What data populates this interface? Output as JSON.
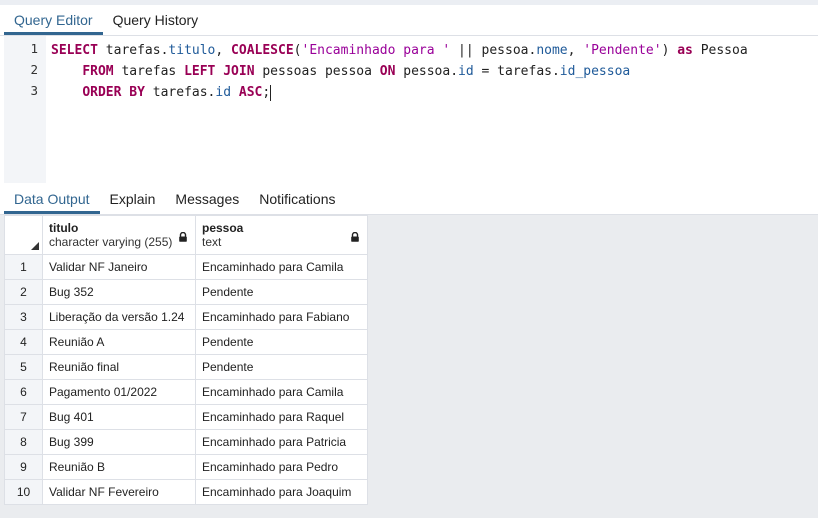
{
  "editor_tabs": [
    {
      "label": "Query Editor",
      "active": true
    },
    {
      "label": "Query History",
      "active": false
    }
  ],
  "query": {
    "line_numbers": [
      "1",
      "2",
      "3"
    ],
    "lines": [
      [
        {
          "t": "SELECT",
          "c": "kw"
        },
        {
          "t": " tarefas.",
          "c": "plain"
        },
        {
          "t": "titulo",
          "c": "prop"
        },
        {
          "t": ", ",
          "c": "plain"
        },
        {
          "t": "COALESCE",
          "c": "kw"
        },
        {
          "t": "(",
          "c": "plain"
        },
        {
          "t": "'Encaminhado para '",
          "c": "str"
        },
        {
          "t": " || pessoa.",
          "c": "plain"
        },
        {
          "t": "nome",
          "c": "prop"
        },
        {
          "t": ", ",
          "c": "plain"
        },
        {
          "t": "'Pendente'",
          "c": "str"
        },
        {
          "t": ") ",
          "c": "plain"
        },
        {
          "t": "as",
          "c": "kw"
        },
        {
          "t": " Pessoa",
          "c": "plain"
        }
      ],
      [
        {
          "t": "    ",
          "c": "plain"
        },
        {
          "t": "FROM",
          "c": "kw"
        },
        {
          "t": " tarefas ",
          "c": "plain"
        },
        {
          "t": "LEFT JOIN",
          "c": "kw"
        },
        {
          "t": " pessoas pessoa ",
          "c": "plain"
        },
        {
          "t": "ON",
          "c": "kw"
        },
        {
          "t": " pessoa.",
          "c": "plain"
        },
        {
          "t": "id",
          "c": "prop"
        },
        {
          "t": " = tarefas.",
          "c": "plain"
        },
        {
          "t": "id_pessoa",
          "c": "prop"
        }
      ],
      [
        {
          "t": "    ",
          "c": "plain"
        },
        {
          "t": "ORDER BY",
          "c": "kw"
        },
        {
          "t": " tarefas.",
          "c": "plain"
        },
        {
          "t": "id",
          "c": "prop"
        },
        {
          "t": " ",
          "c": "plain"
        },
        {
          "t": "ASC",
          "c": "kw"
        },
        {
          "t": ";",
          "c": "plain"
        }
      ]
    ]
  },
  "output_tabs": [
    {
      "label": "Data Output",
      "active": true
    },
    {
      "label": "Explain",
      "active": false
    },
    {
      "label": "Messages",
      "active": false
    },
    {
      "label": "Notifications",
      "active": false
    }
  ],
  "grid": {
    "columns": [
      {
        "name": "titulo",
        "type": "character varying (255)",
        "icon": "lock-icon"
      },
      {
        "name": "pessoa",
        "type": "text",
        "icon": "lock-icon"
      }
    ],
    "rows": [
      [
        "1",
        "Validar NF Janeiro",
        "Encaminhado para Camila"
      ],
      [
        "2",
        "Bug 352",
        "Pendente"
      ],
      [
        "3",
        "Liberação da versão 1.24",
        "Encaminhado para Fabiano"
      ],
      [
        "4",
        "Reunião A",
        "Pendente"
      ],
      [
        "5",
        "Reunião final",
        "Pendente"
      ],
      [
        "6",
        "Pagamento 01/2022",
        "Encaminhado para Camila"
      ],
      [
        "7",
        "Bug 401",
        "Encaminhado para Raquel"
      ],
      [
        "8",
        "Bug 399",
        "Encaminhado para Patricia"
      ],
      [
        "9",
        "Reunião B",
        "Encaminhado para Pedro"
      ],
      [
        "10",
        "Validar NF Fevereiro",
        "Encaminhado para Joaquim"
      ]
    ]
  }
}
